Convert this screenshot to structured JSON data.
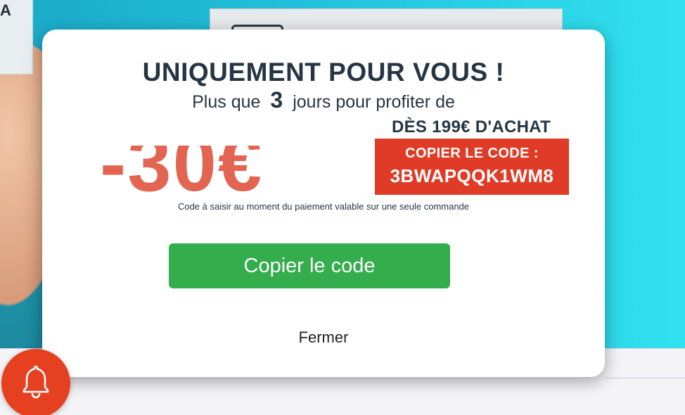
{
  "background": {
    "corner_letter": "A"
  },
  "modal": {
    "title": "UNIQUEMENT POUR VOUS !",
    "subtitle_before": "Plus que",
    "days_left": "3",
    "subtitle_after": "jours pour profiter de",
    "min_purchase": "DÈS 199€ D'ACHAT",
    "discount": "-30€",
    "code_label": "COPIER LE CODE :",
    "code": "3BWAPQQK1WM8",
    "note": "Code à saisir au moment du paiement valable sur une seule commande",
    "copy_button_label": "Copier le code",
    "close_label": "Fermer"
  },
  "colors": {
    "accent_red": "#df3b26",
    "discount_salmon": "#e26451",
    "button_green": "#34ad4c",
    "title_navy": "#263544",
    "bell_orange": "#e5401f"
  },
  "icons": {
    "notification": "bell-icon"
  }
}
